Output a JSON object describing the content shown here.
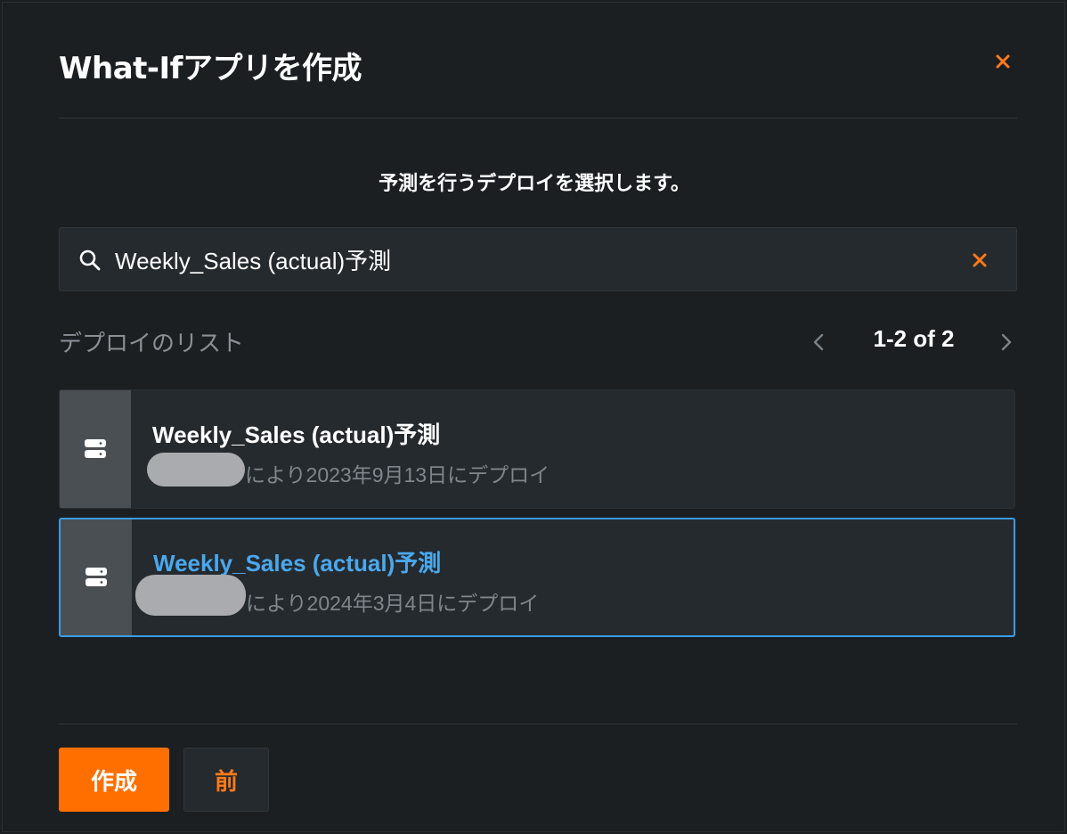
{
  "dialog": {
    "title": "What-Ifアプリを作成",
    "prompt": "予測を行うデプロイを選択します。",
    "accent": "#ff6f00",
    "selected_color": "#3a9ce8"
  },
  "search": {
    "value": "Weekly_Sales (actual)予測",
    "icon": "search-icon",
    "clear_icon": "close-icon"
  },
  "list": {
    "label": "デプロイのリスト",
    "pagination": "1-2 of 2",
    "items": [
      {
        "title": "Weekly_Sales (actual)予測",
        "meta": "により2023年9月13日にデプロイ",
        "icon": "server-icon",
        "selected": false
      },
      {
        "title": "Weekly_Sales (actual)予測",
        "meta": "により2024年3月4日にデプロイ",
        "icon": "server-icon",
        "selected": true
      }
    ]
  },
  "footer": {
    "create_label": "作成",
    "back_label": "前"
  }
}
